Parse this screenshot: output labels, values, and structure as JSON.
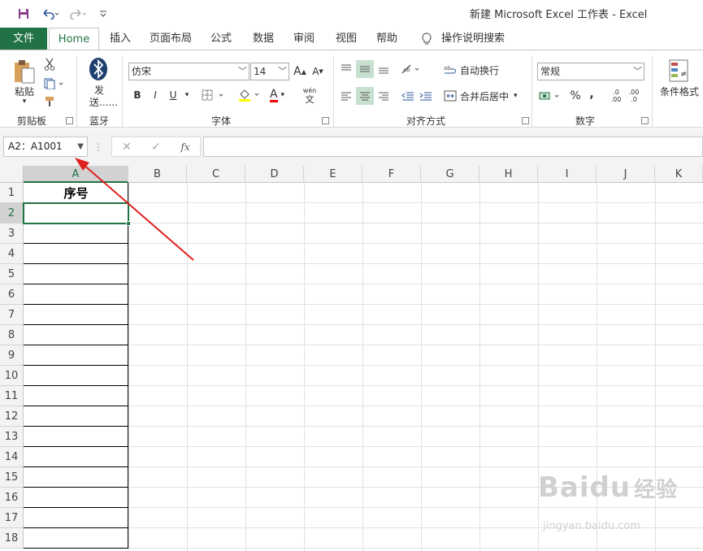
{
  "title": "新建 Microsoft Excel 工作表  -  Excel",
  "quick_access": {
    "save": "save-icon",
    "undo": "undo-icon",
    "redo": "redo-icon",
    "customize": "customize-icon"
  },
  "tabs": [
    "文件",
    "Home",
    "插入",
    "页面布局",
    "公式",
    "数据",
    "审阅",
    "视图",
    "帮助"
  ],
  "search_label": "操作说明搜索",
  "ribbon": {
    "clipboard": {
      "paste": "粘贴",
      "group": "剪贴板"
    },
    "bluetooth": {
      "send": "发送......",
      "group": "蓝牙"
    },
    "font": {
      "name": "仿宋",
      "size": "14",
      "bold": "B",
      "italic": "I",
      "underline": "U",
      "grow": "A",
      "shrink": "A",
      "font_color": "A",
      "phonetic_top": "wén",
      "phonetic_bottom": "文",
      "group": "字体"
    },
    "alignment": {
      "wrap": "自动换行",
      "merge": "合并后居中",
      "group": "对齐方式"
    },
    "number": {
      "format": "常规",
      "percent": "%",
      "comma": ",",
      "inc": ".00",
      "dec": ".0",
      "group": "数字"
    },
    "styles": {
      "cond": "条件格式"
    }
  },
  "formula_bar": {
    "name_box": "A2：A1001",
    "cancel": "✕",
    "enter": "✓",
    "fx": "fx",
    "content": ""
  },
  "columns": [
    "A",
    "B",
    "C",
    "D",
    "E",
    "F",
    "G",
    "H",
    "I",
    "J",
    "K"
  ],
  "rows": [
    "1",
    "2",
    "3",
    "4",
    "5",
    "6",
    "7",
    "8",
    "9",
    "10",
    "11",
    "12",
    "13",
    "14",
    "15",
    "16",
    "17",
    "18"
  ],
  "cells": {
    "A1": "序号"
  },
  "active_column": "A",
  "active_row": "2",
  "accent": "#217346",
  "watermark": {
    "brand": "Baidu",
    "cn": "经验",
    "url": "jingyan.baidu.com"
  }
}
